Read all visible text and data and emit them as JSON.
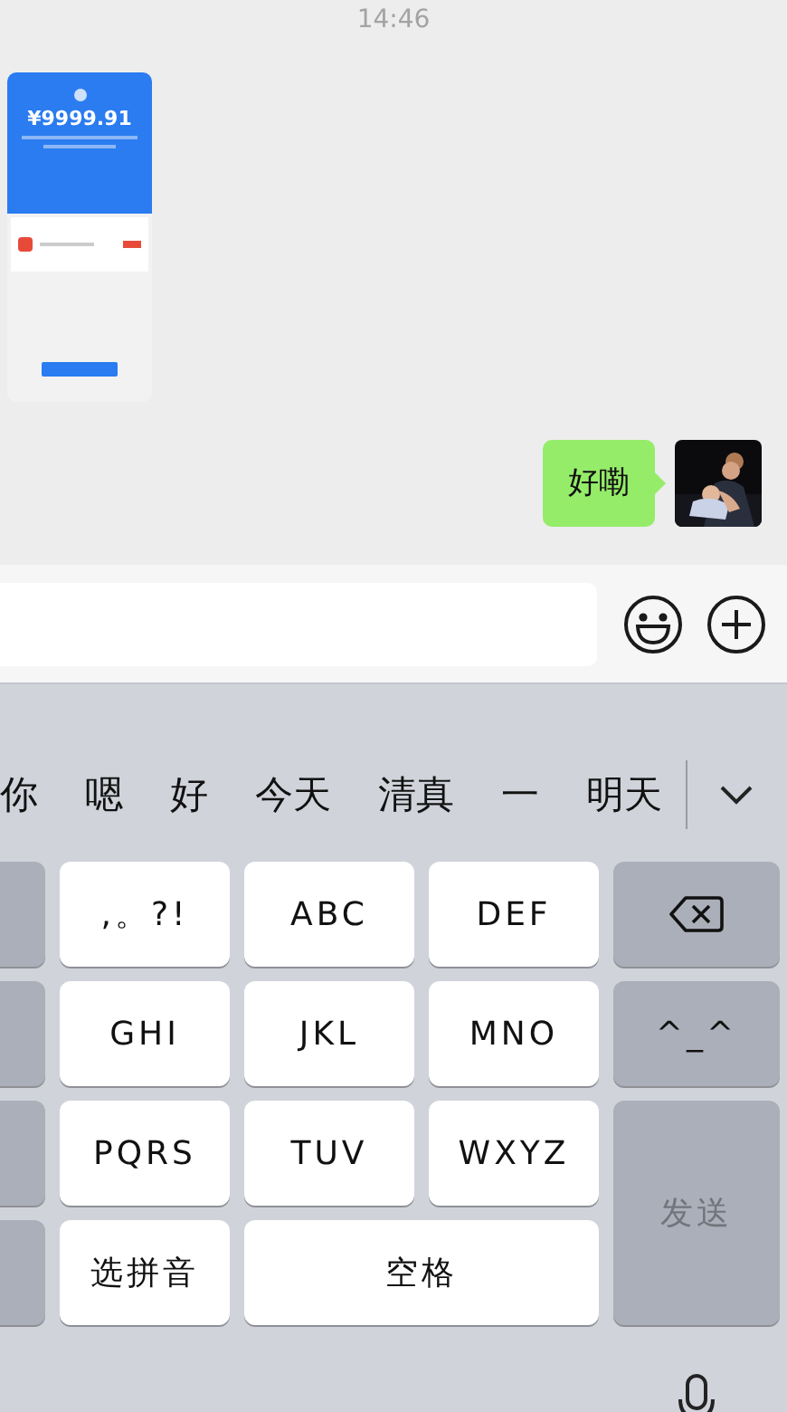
{
  "time": "14:46",
  "messages": [
    {
      "amount": "¥9999.91"
    },
    {
      "kind": "text",
      "text": "好嘞"
    }
  ],
  "candidates": [
    "你",
    "嗯",
    "好",
    "今天",
    "清真",
    "一",
    "明天"
  ],
  "keys": [
    {
      "kind": "char",
      "label": ",。?!"
    },
    {
      "kind": "char",
      "label": "ABC"
    },
    {
      "kind": "char",
      "label": "DEF"
    },
    {
      "kind": "delete"
    },
    {
      "kind": "char",
      "label": "GHI"
    },
    {
      "kind": "char",
      "label": "JKL"
    },
    {
      "kind": "char",
      "label": "MNO"
    },
    {
      "kind": "func",
      "label": "^_^"
    },
    {
      "kind": "char",
      "label": "PQRS"
    },
    {
      "kind": "char",
      "label": "TUV"
    },
    {
      "kind": "char",
      "label": "WXYZ"
    },
    {
      "kind": "send",
      "label": "发送",
      "disabled": true
    },
    {
      "kind": "char",
      "label": "选拼音"
    },
    {
      "kind": "space",
      "label": "空格"
    }
  ]
}
